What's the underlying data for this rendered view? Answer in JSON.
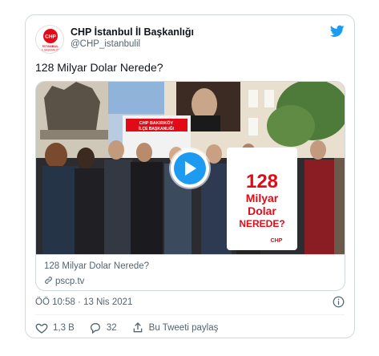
{
  "tweet": {
    "author_name": "CHP İstanbul İl Başkanlığı",
    "author_handle": "@CHP_istanbulil",
    "avatar": {
      "logo_text": "CHP",
      "caption_line1": "İSTANBUL",
      "caption_line2": "İL BAŞKANLIĞI"
    },
    "text": "128 Milyar Dolar Nerede?",
    "media": {
      "sign_line1": "128",
      "sign_line2": "Milyar",
      "sign_line3": "Dolar",
      "sign_line4": "NEREDE?",
      "sign_logo": "CHP",
      "bus_line1": "CHP BAKIRKÖY",
      "bus_line2": "İLÇE BAŞKANLIĞI",
      "link_title": "128 Milyar Dolar Nerede?",
      "link_domain": "pscp.tv"
    },
    "timestamp": "ÖÖ 10:58 · 13 Nis 2021",
    "likes": "1,3 B",
    "replies": "32",
    "share_label": "Bu Tweeti paylaş"
  },
  "icons": {
    "brand": "twitter-bird-icon",
    "play": "play-icon",
    "link": "link-icon",
    "info": "info-icon",
    "like": "heart-icon",
    "reply": "reply-icon",
    "share": "share-icon"
  },
  "colors": {
    "accent": "#1d9bf0",
    "chp_red": "#e30a17",
    "text_secondary": "#536471",
    "border": "#cfd9de"
  }
}
